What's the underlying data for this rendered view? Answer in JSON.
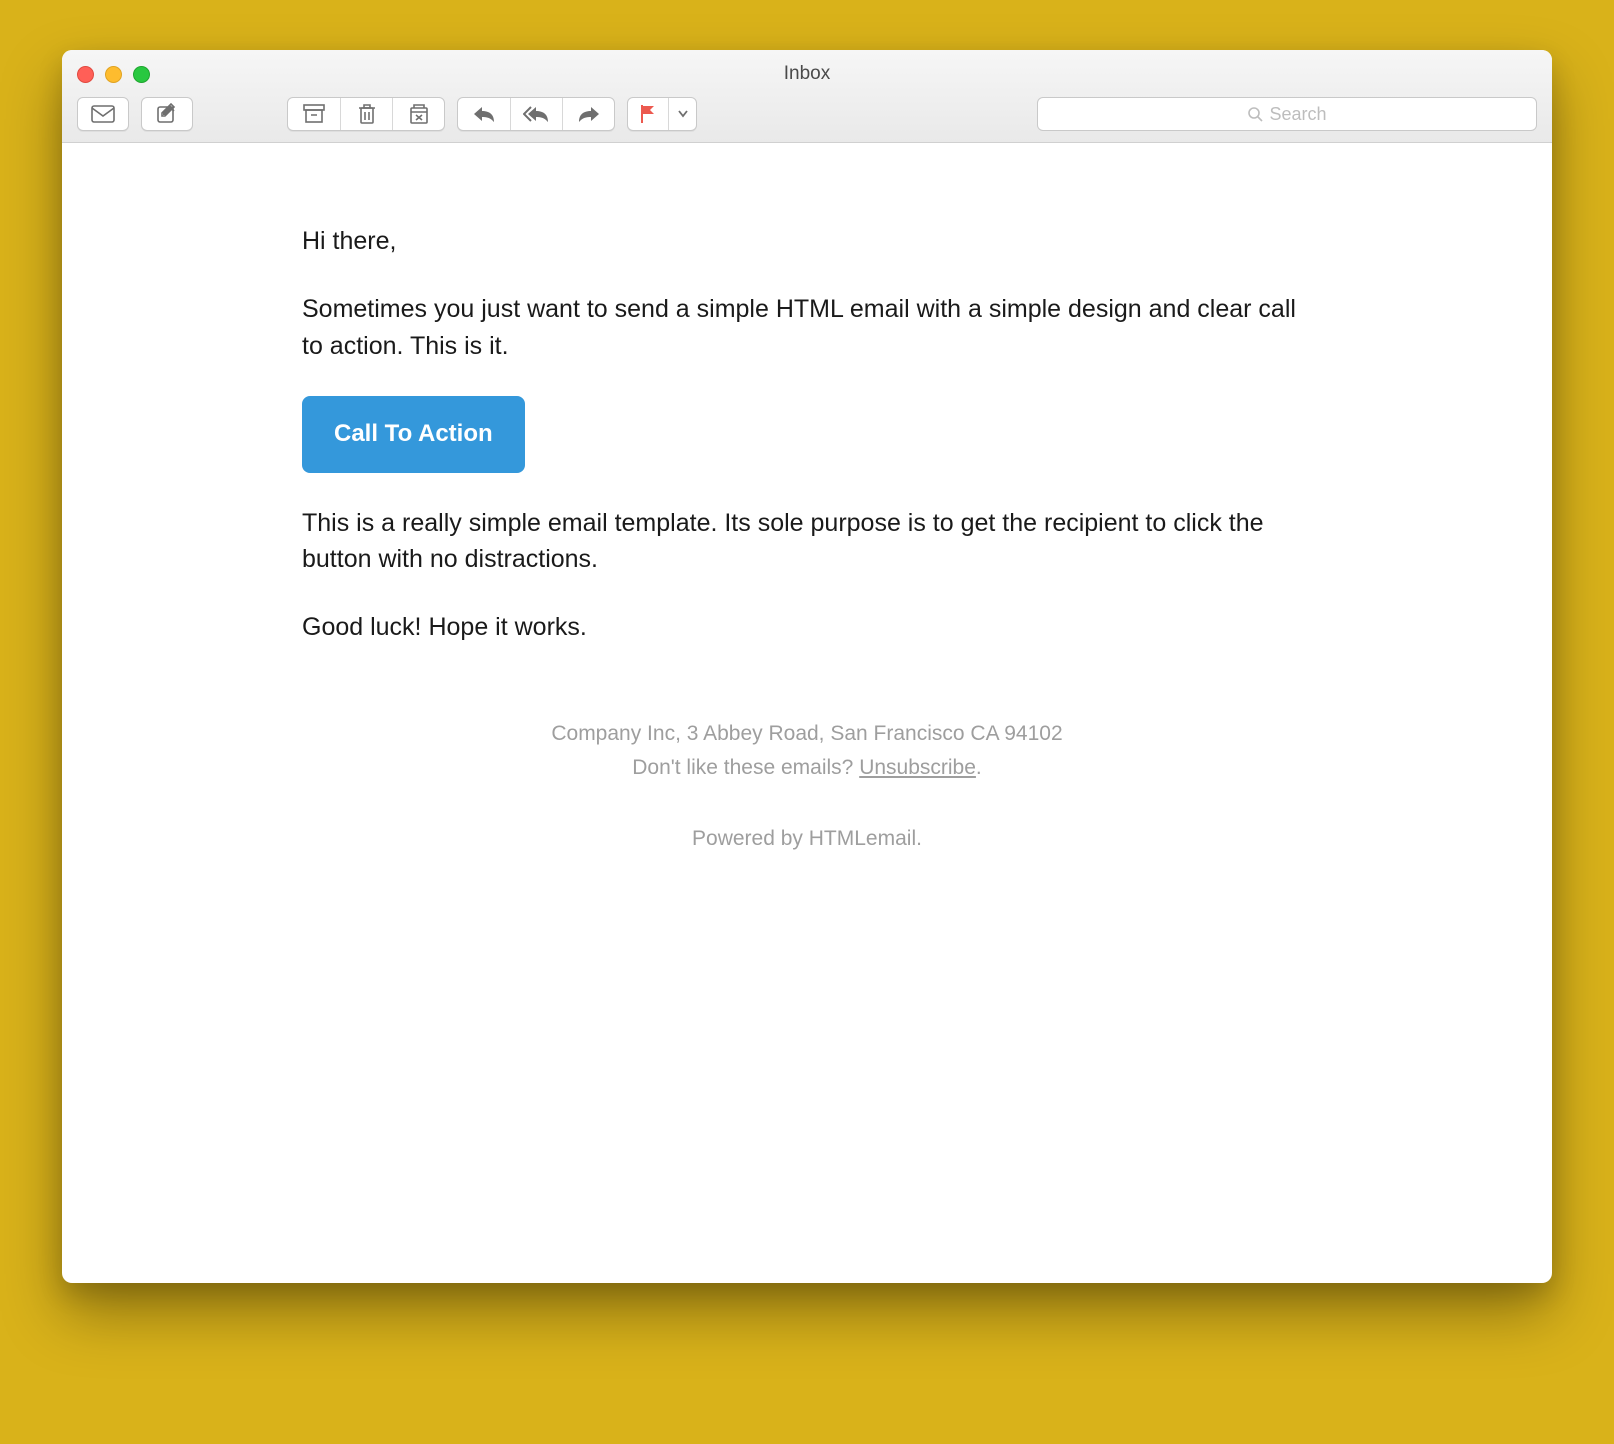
{
  "window": {
    "title": "Inbox"
  },
  "search": {
    "placeholder": "Search"
  },
  "email": {
    "greeting": "Hi there,",
    "intro": "Sometimes you just want to send a simple HTML email with a simple design and clear call to action. This is it.",
    "cta_label": "Call To Action",
    "body": "This is a really simple email template. Its sole purpose is to get the recipient to click the button with no distractions.",
    "closing": "Good luck! Hope it works."
  },
  "footer": {
    "address": "Company Inc, 3 Abbey Road, San Francisco CA 94102",
    "unsubscribe_prefix": "Don't like these emails? ",
    "unsubscribe_label": "Unsubscribe",
    "unsubscribe_suffix": ".",
    "powered_prefix": "Powered by ",
    "powered_label": "HTMLemail",
    "powered_suffix": "."
  }
}
